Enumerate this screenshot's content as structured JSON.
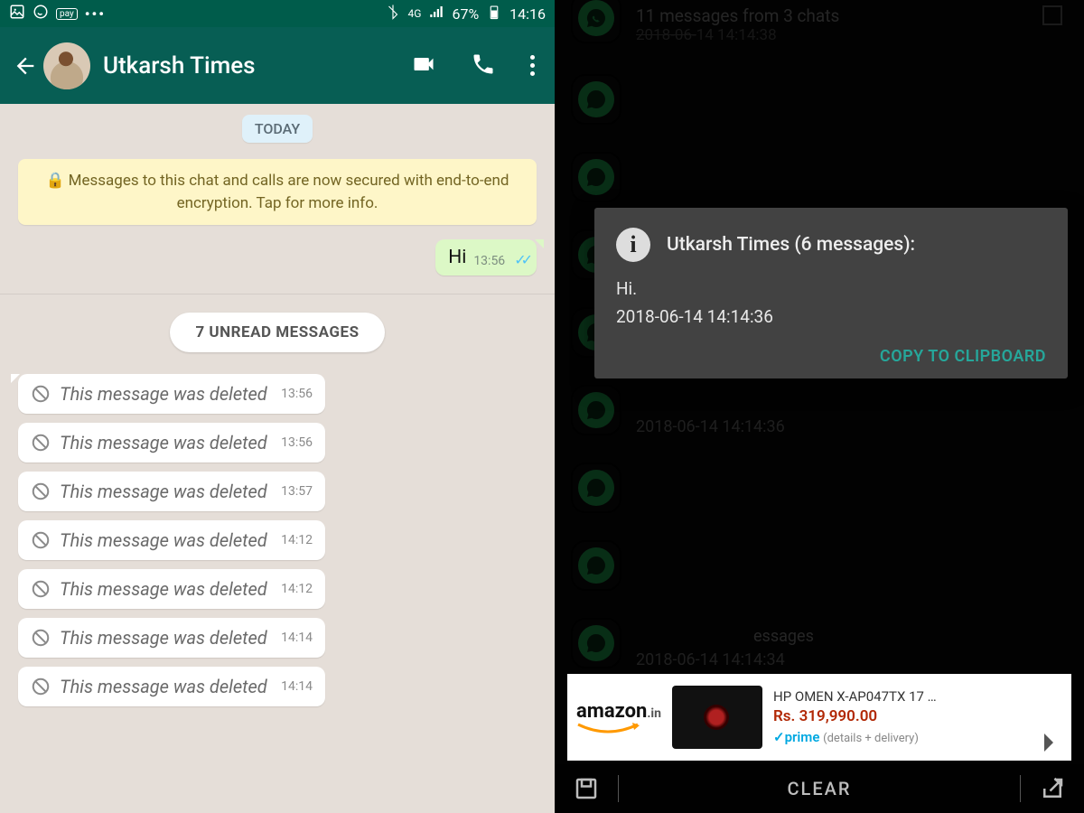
{
  "status": {
    "network": "4G",
    "battery": "67%",
    "time": "14:16",
    "dots": "•••"
  },
  "header": {
    "title": "Utkarsh Times"
  },
  "chat": {
    "date_chip": "TODAY",
    "encryption": "Messages to this chat and calls are now secured with end-to-end encryption. Tap for more info.",
    "out": {
      "text": "Hi",
      "time": "13:56"
    },
    "unread": "7 UNREAD MESSAGES",
    "deleted_label": "This message was deleted",
    "deleted": [
      {
        "time": "13:56"
      },
      {
        "time": "13:56"
      },
      {
        "time": "13:57"
      },
      {
        "time": "14:12"
      },
      {
        "time": "14:12"
      },
      {
        "time": "14:14"
      },
      {
        "time": "14:14"
      }
    ]
  },
  "log": {
    "summary": "11 messages from 3 chats",
    "summary_ts_strike": "2018-06-",
    "summary_ts_rest": "14 14:14:38",
    "rows": [
      {
        "ts": "2018-06-14 14:14:36"
      },
      {
        "ts": "2018-06-14 14:14:34"
      }
    ],
    "msg_frag": "essages"
  },
  "dialog": {
    "title": "Utkarsh Times (6 messages):",
    "line1": "Hi.",
    "line2": "2018-06-14 14:14:36",
    "action": "COPY TO CLIPBOARD"
  },
  "ad": {
    "brand": "amazon",
    "tld": ".in",
    "product": "HP OMEN X-AP047TX 17 …",
    "price": "Rs. 319,990.00",
    "prime": "✓prime",
    "details": "(details + delivery)"
  },
  "bottom": {
    "clear": "CLEAR"
  }
}
